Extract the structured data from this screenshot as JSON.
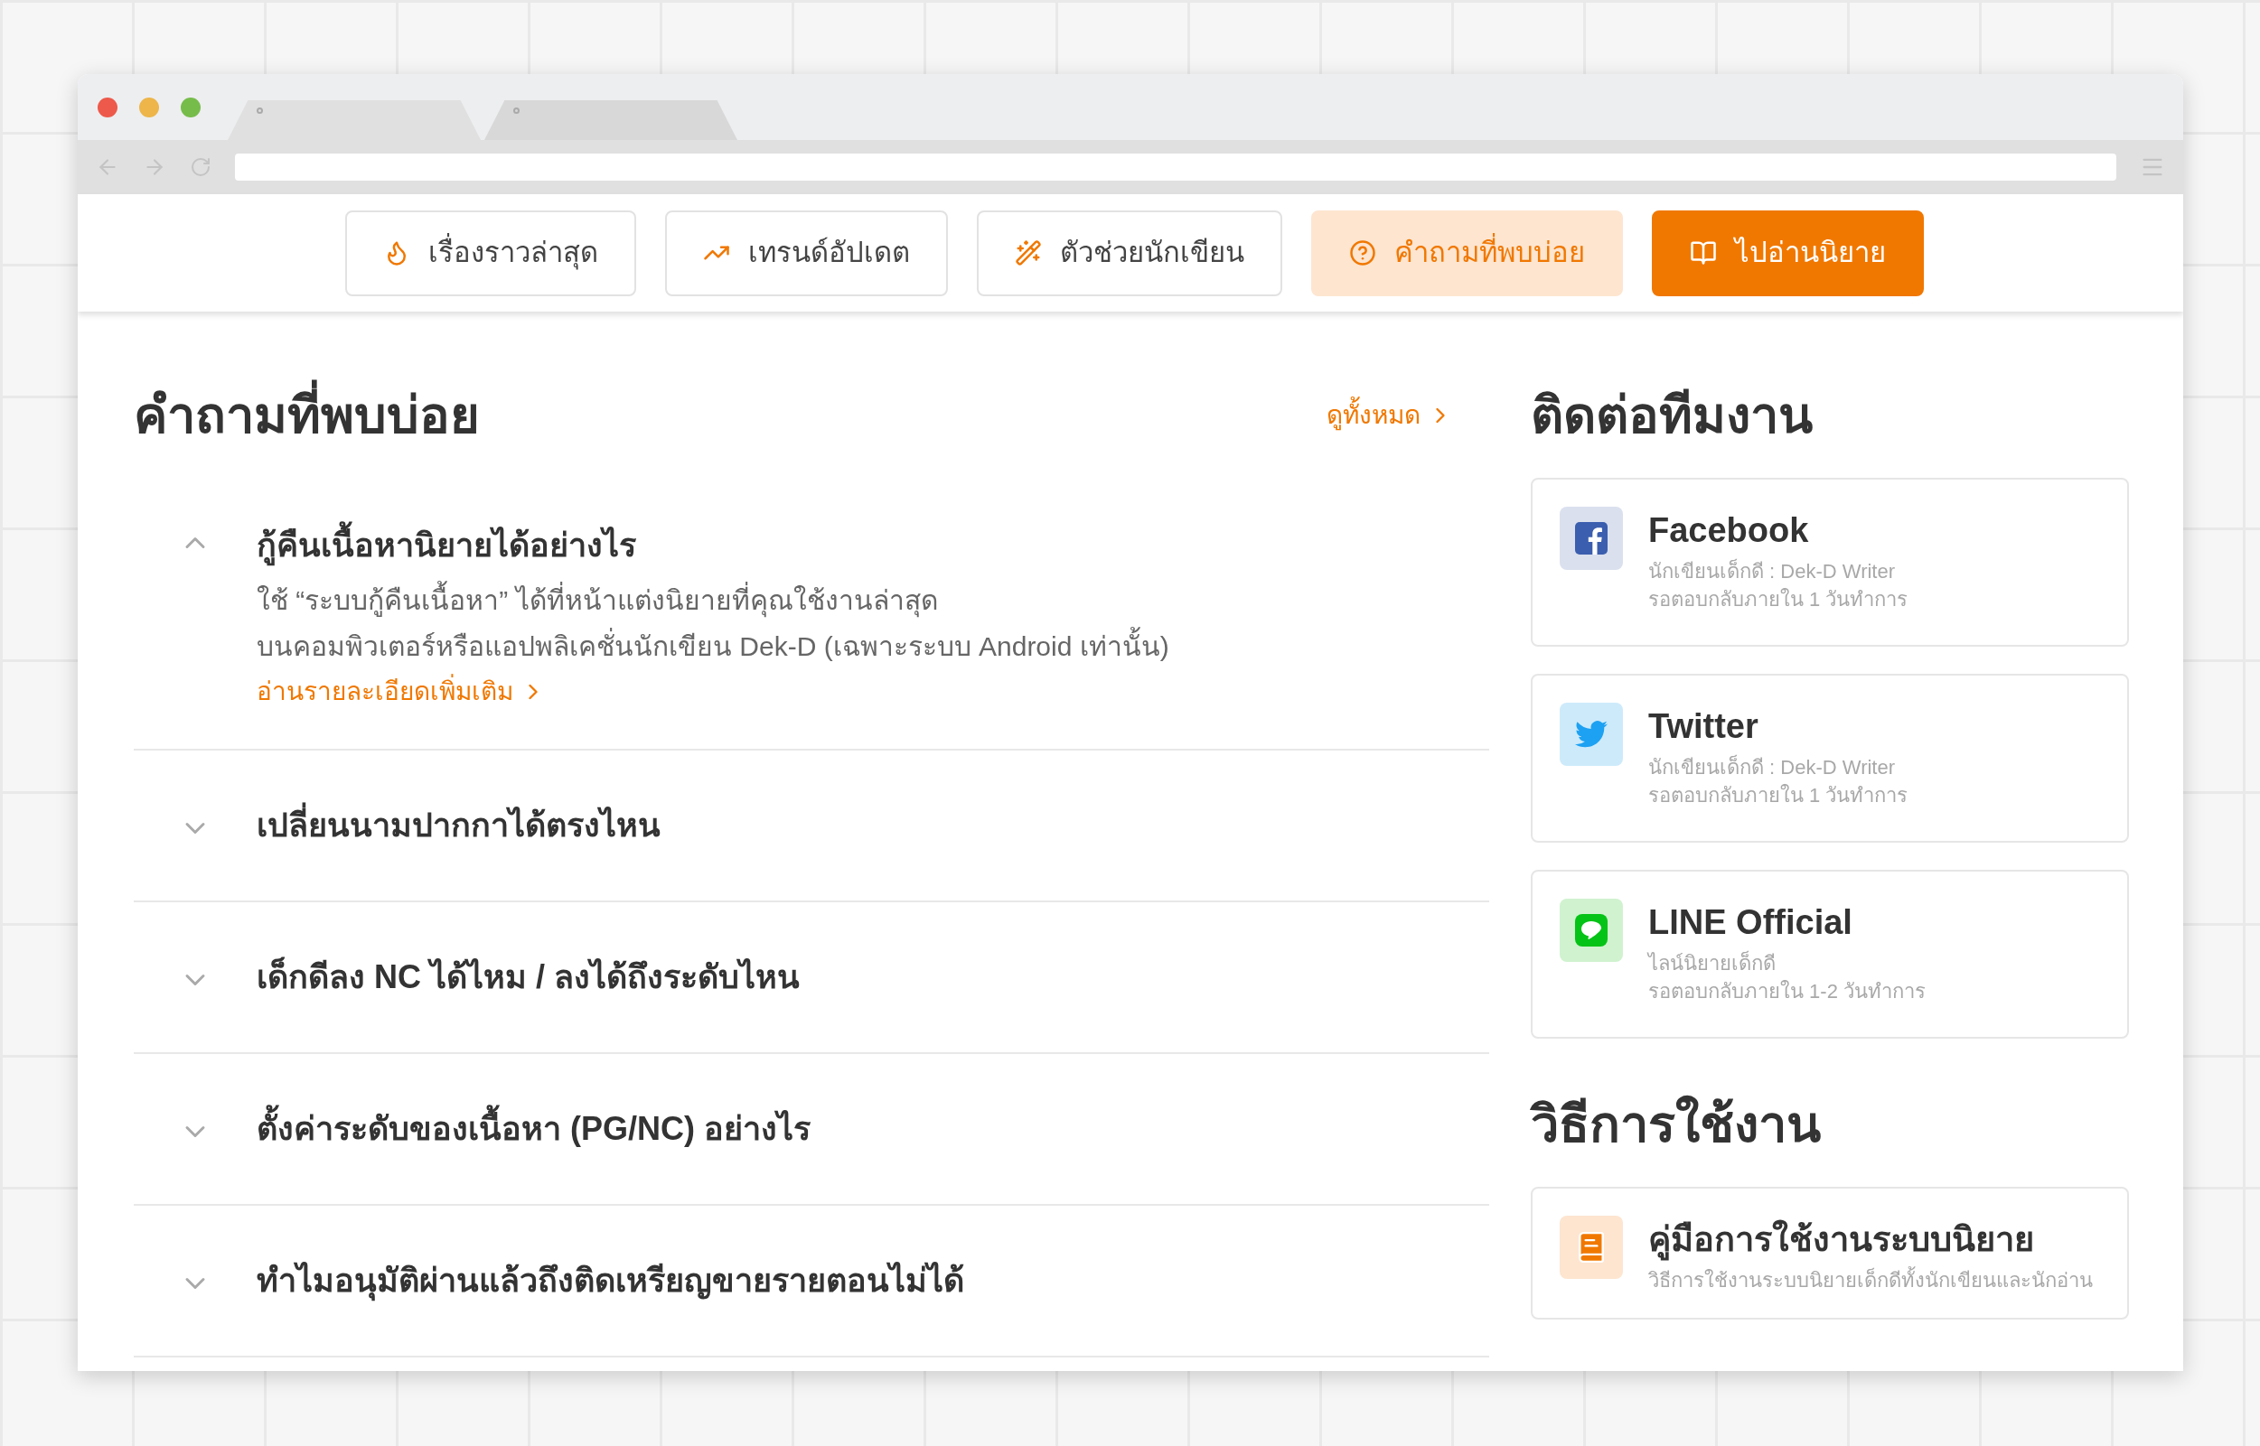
{
  "nav": [
    {
      "label": "เรื่องราวล่าสุด",
      "kind": "outline"
    },
    {
      "label": "เทรนด์อัปเดต",
      "kind": "outline"
    },
    {
      "label": "ตัวช่วยนักเขียน",
      "kind": "outline"
    },
    {
      "label": "คำถามที่พบบ่อย",
      "kind": "active"
    },
    {
      "label": "ไปอ่านนิยาย",
      "kind": "primary"
    }
  ],
  "faq": {
    "title": "คำถามที่พบบ่อย",
    "see_all": "ดูทั้งหมด",
    "items": [
      {
        "question": "กู้คืนเนื้อหานิยายได้อย่างไร",
        "expanded": true,
        "answer_lines": [
          "ใช้ “ระบบกู้คืนเนื้อหา” ได้ที่หน้าแต่งนิยายที่คุณใช้งานล่าสุด",
          "บนคอมพิวเตอร์หรือแอปพลิเคชั่นนักเขียน Dek-D (เฉพาะระบบ Android เท่านั้น)"
        ],
        "link": "อ่านรายละเอียดเพิ่มเติม"
      },
      {
        "question": "เปลี่ยนนามปากกาได้ตรงไหน",
        "expanded": false
      },
      {
        "question": "เด็กดีลง NC ได้ไหม / ลงได้ถึงระดับไหน",
        "expanded": false
      },
      {
        "question": "ตั้งค่าระดับของเนื้อหา (PG/NC) อย่างไร",
        "expanded": false
      },
      {
        "question": "ทำไมอนุมัติผ่านแล้วถึงติดเหรียญขายรายตอนไม่ได้",
        "expanded": false
      }
    ]
  },
  "contact": {
    "title": "ติดต่อทีมงาน",
    "cards": [
      {
        "name": "Facebook",
        "lines": [
          "นักเขียนเด็กดี : Dek-D Writer",
          "รอตอบกลับภายใน 1 วันทำการ"
        ]
      },
      {
        "name": "Twitter",
        "lines": [
          "นักเขียนเด็กดี : Dek-D Writer",
          "รอตอบกลับภายใน 1 วันทำการ"
        ]
      },
      {
        "name": "LINE Official",
        "lines": [
          "ไลน์นิยายเด็กดี",
          "รอตอบกลับภายใน 1-2 วันทำการ"
        ]
      }
    ]
  },
  "guide": {
    "title": "วิธีการใช้งาน",
    "cards": [
      {
        "name": "คู่มือการใช้งานระบบนิยาย",
        "lines": [
          "วิธีการใช้งานระบบนิยายเด็กดีทั้งนักเขียนและนักอ่าน"
        ]
      }
    ]
  }
}
